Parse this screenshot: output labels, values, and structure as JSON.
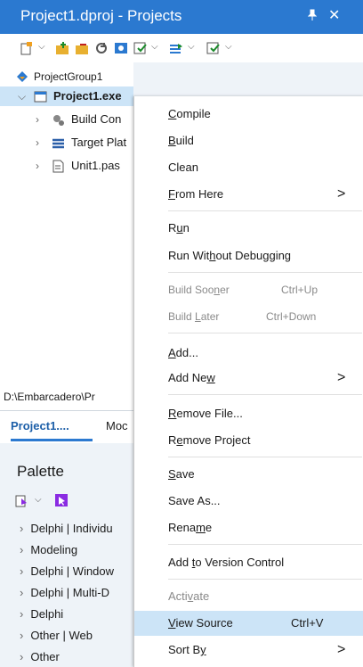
{
  "window": {
    "title": "Project1.dproj - Projects",
    "pin_glyph": "↑",
    "close_glyph": "✕"
  },
  "toolbar": {
    "icons": [
      "new-item-icon",
      "add-icon",
      "remove-icon",
      "refresh-icon",
      "sync-icon",
      "build-icon",
      "compile-all-icon",
      "build-config-icon"
    ]
  },
  "tree": {
    "group": "ProjectGroup1",
    "project": "Project1.exe",
    "children": [
      "Build Con",
      "Target Plat",
      "Unit1.pas"
    ]
  },
  "path": "D:\\Embarcadero\\Pr",
  "tabs": {
    "project": "Project1....",
    "model": "Moc"
  },
  "palette": {
    "title": "Palette",
    "items": [
      "Delphi | Individu",
      "Modeling",
      "Delphi | Window",
      "Delphi | Multi-D",
      "Delphi",
      "Other | Web",
      "Other"
    ]
  },
  "menu": {
    "compile": {
      "pre": "",
      "u": "C",
      "post": "ompile"
    },
    "build": {
      "pre": "",
      "u": "B",
      "post": "uild"
    },
    "clean": {
      "pre": "Clean",
      "u": "",
      "post": ""
    },
    "from_here": {
      "pre": "",
      "u": "F",
      "post": "rom Here"
    },
    "run": {
      "pre": "R",
      "u": "u",
      "post": "n"
    },
    "run_wo": {
      "pre": "Run Wit",
      "u": "h",
      "post": "out Debugging"
    },
    "build_sooner": {
      "pre": "Build Soo",
      "u": "n",
      "post": "er",
      "shortcut": "Ctrl+Up"
    },
    "build_later": {
      "pre": "Build ",
      "u": "L",
      "post": "ater",
      "shortcut": "Ctrl+Down"
    },
    "add": {
      "pre": "",
      "u": "A",
      "post": "dd..."
    },
    "add_new": {
      "pre": "Add Ne",
      "u": "w",
      "post": ""
    },
    "remove_file": {
      "pre": "",
      "u": "R",
      "post": "emove File..."
    },
    "remove_project": {
      "pre": "R",
      "u": "e",
      "post": "move Project"
    },
    "save": {
      "pre": "",
      "u": "S",
      "post": "ave"
    },
    "save_as": {
      "pre": "Save As...",
      "u": "",
      "post": ""
    },
    "rename": {
      "pre": "Rena",
      "u": "m",
      "post": "e"
    },
    "add_vc": {
      "pre": "Add ",
      "u": "t",
      "post": "o Version Control"
    },
    "activate": {
      "pre": "Acti",
      "u": "v",
      "post": "ate"
    },
    "view_source": {
      "pre": "",
      "u": "V",
      "post": "iew Source",
      "shortcut": "Ctrl+V"
    },
    "sort_by": {
      "pre": "Sort B",
      "u": "y",
      "post": ""
    },
    "arrow": ">"
  }
}
